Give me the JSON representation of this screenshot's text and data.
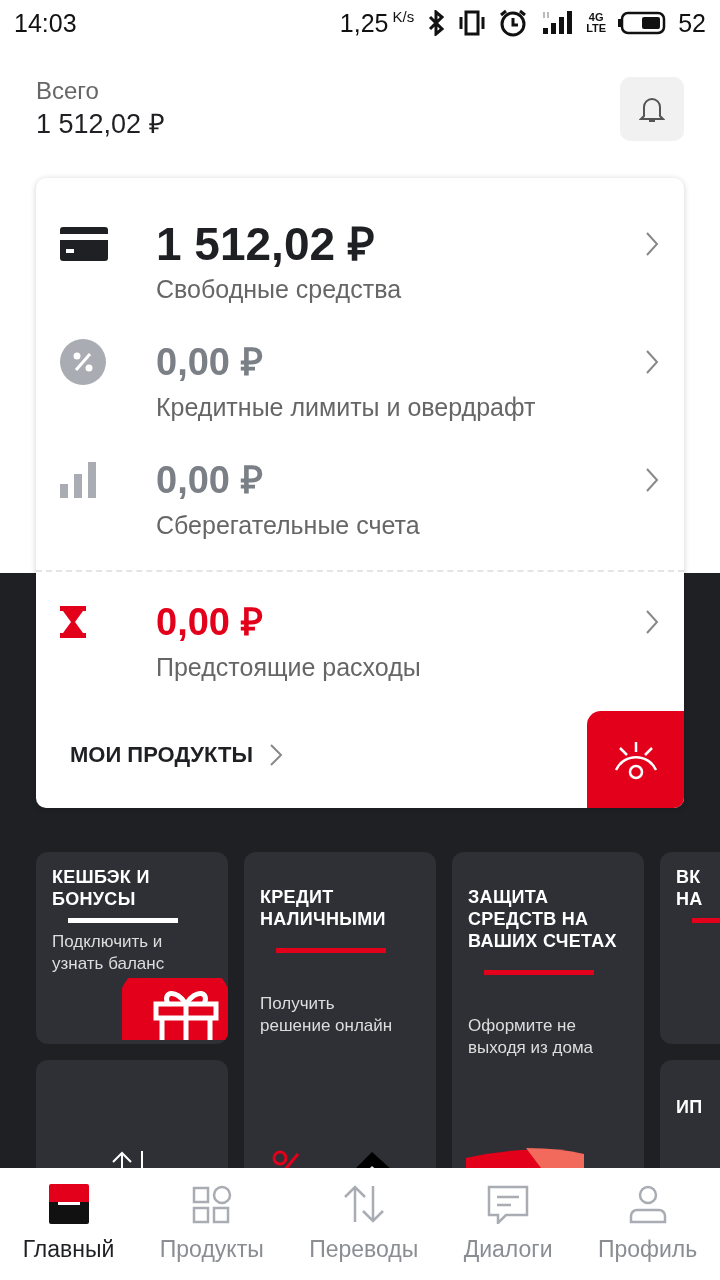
{
  "status_bar": {
    "time": "14:03",
    "speed": "1,25",
    "speed_unit": "K/s",
    "network": [
      "4G",
      "LTE"
    ],
    "battery": "52"
  },
  "summary": {
    "label": "Всего",
    "total": "1 512,02 ₽"
  },
  "balances": [
    {
      "kind": "card",
      "amount": "1 512,02 ₽",
      "label": "Свободные средства",
      "color": "#1f2024"
    },
    {
      "kind": "percent",
      "amount": "0,00 ₽",
      "label": "Кредитные лимиты и овердрафт",
      "color": "#7b7f86"
    },
    {
      "kind": "bars",
      "amount": "0,00 ₽",
      "label": "Сберегательные счета",
      "color": "#7b7f86"
    },
    {
      "kind": "hourglass",
      "amount": "0,00 ₽",
      "label": "Предстоящие расходы",
      "color": "#e3001b"
    }
  ],
  "products_link": "МОИ ПРОДУКТЫ",
  "tile_columns": [
    [
      {
        "kind": "promo",
        "title": "КЕШБЭК И\nБОНУСЫ",
        "subtitle": "Подключить и\nузнать баланс"
      },
      {
        "kind": "icon"
      }
    ],
    [
      {
        "kind": "tall",
        "title": "КРЕДИТ\nНАЛИЧНЫМИ",
        "subtitle": "Получить\nрешение онлайн"
      }
    ],
    [
      {
        "kind": "tall",
        "title": "ЗАЩИТА\nСРЕДСТВ НА\nВАШИХ СЧЕТАХ",
        "subtitle": "Оформите не\nвыходя из дома"
      }
    ],
    [
      {
        "kind": "promo",
        "title": "ВК\nНА"
      },
      {
        "kind": "label",
        "title": "ИП"
      }
    ]
  ],
  "nav": [
    {
      "label": "Главный",
      "selected": true
    },
    {
      "label": "Продукты",
      "selected": false
    },
    {
      "label": "Переводы",
      "selected": false
    },
    {
      "label": "Диалоги",
      "selected": false
    },
    {
      "label": "Профиль",
      "selected": false
    }
  ]
}
